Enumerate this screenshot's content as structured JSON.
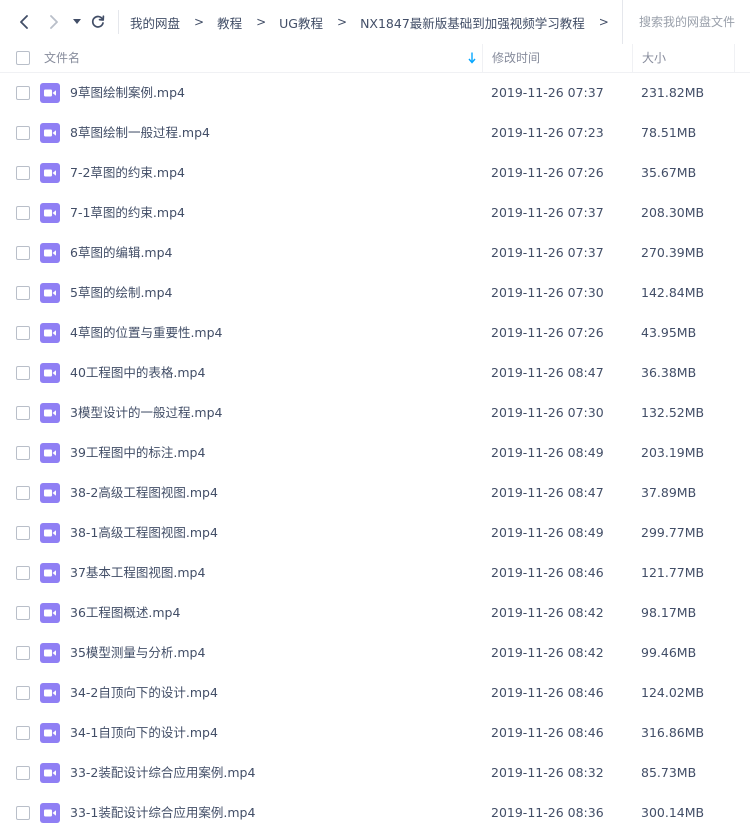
{
  "nav": {
    "back_icon": "chevron-left-icon",
    "forward_icon": "chevron-right-icon",
    "history_icon": "caret-down-icon",
    "refresh_icon": "refresh-icon"
  },
  "breadcrumb": [
    "我的网盘",
    "教程",
    "UG教程",
    "NX1847最新版基础到加强视频学习教程"
  ],
  "breadcrumb_separator": ">",
  "search": {
    "placeholder": "搜索我的网盘文件"
  },
  "columns": {
    "name": "文件名",
    "modified": "修改时间",
    "size": "大小"
  },
  "colors": {
    "icon": "#8f7ff4",
    "accent": "#06a7ff"
  },
  "files": [
    {
      "name": "9草图绘制案例.mp4",
      "modified": "2019-11-26 07:37",
      "size": "231.82MB"
    },
    {
      "name": "8草图绘制一般过程.mp4",
      "modified": "2019-11-26 07:23",
      "size": "78.51MB"
    },
    {
      "name": "7-2草图的约束.mp4",
      "modified": "2019-11-26 07:26",
      "size": "35.67MB"
    },
    {
      "name": "7-1草图的约束.mp4",
      "modified": "2019-11-26 07:37",
      "size": "208.30MB"
    },
    {
      "name": "6草图的编辑.mp4",
      "modified": "2019-11-26 07:37",
      "size": "270.39MB"
    },
    {
      "name": "5草图的绘制.mp4",
      "modified": "2019-11-26 07:30",
      "size": "142.84MB"
    },
    {
      "name": "4草图的位置与重要性.mp4",
      "modified": "2019-11-26 07:26",
      "size": "43.95MB"
    },
    {
      "name": "40工程图中的表格.mp4",
      "modified": "2019-11-26 08:47",
      "size": "36.38MB"
    },
    {
      "name": "3模型设计的一般过程.mp4",
      "modified": "2019-11-26 07:30",
      "size": "132.52MB"
    },
    {
      "name": "39工程图中的标注.mp4",
      "modified": "2019-11-26 08:49",
      "size": "203.19MB"
    },
    {
      "name": "38-2高级工程图视图.mp4",
      "modified": "2019-11-26 08:47",
      "size": "37.89MB"
    },
    {
      "name": "38-1高级工程图视图.mp4",
      "modified": "2019-11-26 08:49",
      "size": "299.77MB"
    },
    {
      "name": "37基本工程图视图.mp4",
      "modified": "2019-11-26 08:46",
      "size": "121.77MB"
    },
    {
      "name": "36工程图概述.mp4",
      "modified": "2019-11-26 08:42",
      "size": "98.17MB"
    },
    {
      "name": "35模型测量与分析.mp4",
      "modified": "2019-11-26 08:42",
      "size": "99.46MB"
    },
    {
      "name": "34-2自顶向下的设计.mp4",
      "modified": "2019-11-26 08:46",
      "size": "124.02MB"
    },
    {
      "name": "34-1自顶向下的设计.mp4",
      "modified": "2019-11-26 08:46",
      "size": "316.86MB"
    },
    {
      "name": "33-2装配设计综合应用案例.mp4",
      "modified": "2019-11-26 08:32",
      "size": "85.73MB"
    },
    {
      "name": "33-1装配设计综合应用案例.mp4",
      "modified": "2019-11-26 08:36",
      "size": "300.14MB"
    }
  ]
}
